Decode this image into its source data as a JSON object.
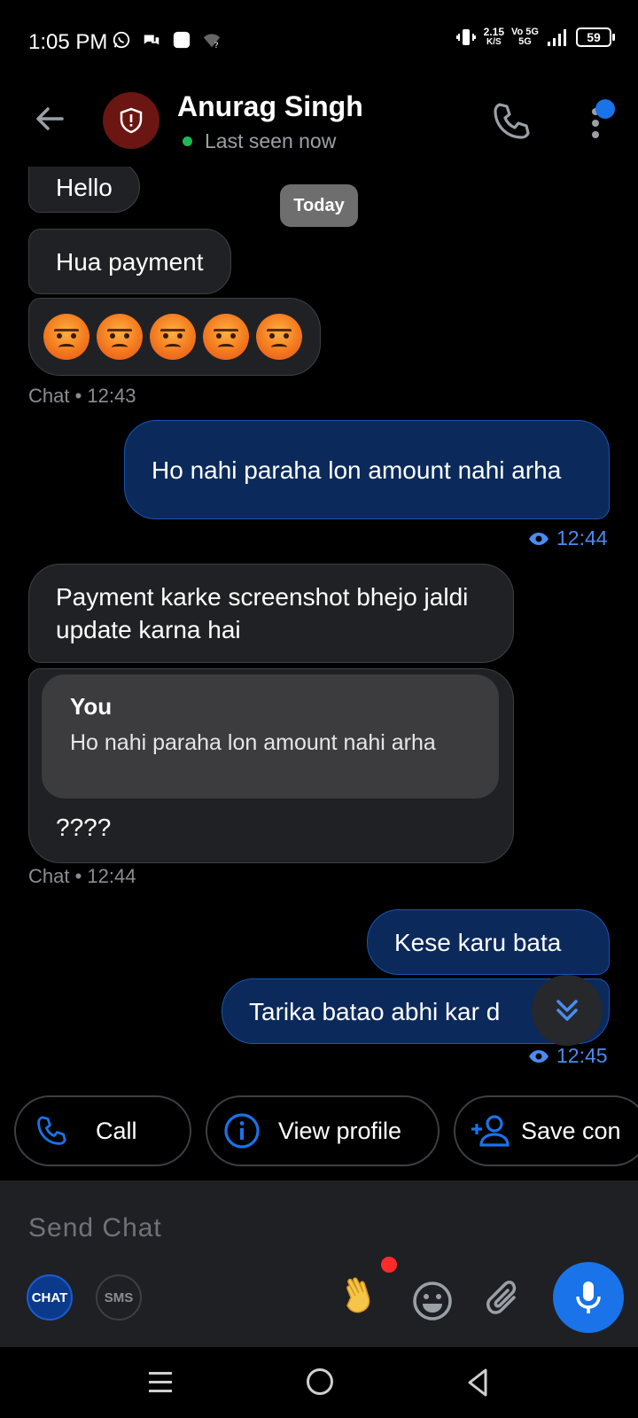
{
  "status_bar": {
    "time": "1:05 PM",
    "speed_value": "2.15",
    "speed_unit": "K/S",
    "net_top": "Vo 5G",
    "net_bottom": "5G",
    "battery": "59"
  },
  "header": {
    "contact_name": "Anurag Singh",
    "presence": "Last seen now",
    "avatar_color": "#6b1612",
    "accent": "#1a73e8"
  },
  "chat": {
    "date_chip": "Today",
    "messages": [
      {
        "dir": "in",
        "text": "Hello"
      },
      {
        "dir": "in",
        "text": "Hua payment"
      },
      {
        "dir": "in",
        "emoji": "angry-face",
        "count": 5
      },
      {
        "meta": "Chat • 12:43"
      },
      {
        "dir": "out",
        "text": "Ho nahi paraha lon amount nahi arha"
      },
      {
        "meta_out": "12:44"
      },
      {
        "dir": "in",
        "text": "Payment karke screenshot bhejo jaldi update karna hai"
      },
      {
        "dir": "in",
        "quote_author": "You",
        "quote_text": "Ho nahi paraha lon amount nahi arha",
        "text": "????"
      },
      {
        "meta": "Chat • 12:44"
      },
      {
        "dir": "out",
        "text": "Kese karu bata"
      },
      {
        "dir": "out",
        "text": "Tarika batao abhi kar d"
      },
      {
        "meta_out": "12:45"
      }
    ]
  },
  "quick_actions": {
    "call": "Call",
    "view_profile": "View profile",
    "save_contact": "Save con"
  },
  "composer": {
    "placeholder": "Send Chat",
    "mode_chat": "CHAT",
    "mode_sms": "SMS"
  }
}
